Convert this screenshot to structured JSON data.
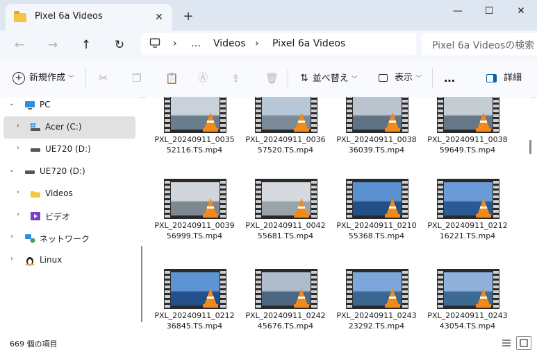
{
  "window": {
    "tab_title": "Pixel 6a Videos",
    "tab_close_icon": "close-icon",
    "new_tab_icon": "plus-icon",
    "minimize_icon": "minimize-icon",
    "maximize_icon": "maximize-icon",
    "close_icon": "close-icon"
  },
  "address": {
    "computer_icon": "computer-icon",
    "overflow": "…",
    "crumbs": [
      "Videos",
      "Pixel 6a Videos"
    ],
    "search_placeholder": "Pixel 6a Videosの検索"
  },
  "toolbar": {
    "new_label": "新規作成",
    "sort_label": "並べ替え",
    "view_label": "表示",
    "more_label": "…",
    "details_label": "詳細"
  },
  "sidebar": {
    "items": [
      {
        "label": "PC",
        "icon": "pc-icon"
      },
      {
        "label": "Acer (C:)",
        "icon": "windows-drive-icon"
      },
      {
        "label": "UE720 (D:)",
        "icon": "drive-icon"
      },
      {
        "label": "UE720 (D:)",
        "icon": "drive-icon"
      },
      {
        "label": "Videos",
        "icon": "folder-icon"
      },
      {
        "label": "ビデオ",
        "icon": "video-folder-icon"
      },
      {
        "label": "ネットワーク",
        "icon": "network-icon"
      },
      {
        "label": "Linux",
        "icon": "linux-icon"
      }
    ]
  },
  "files": [
    {
      "name": "PXL_20240911_003552116.TS.mp4",
      "sky": "#c9d2dc",
      "sea": "#6a7d8c"
    },
    {
      "name": "PXL_20240911_003657520.TS.mp4",
      "sky": "#b8c7d6",
      "sea": "#7a8a96"
    },
    {
      "name": "PXL_20240911_003836039.TS.mp4",
      "sky": "#b9c4cf",
      "sea": "#5f7385"
    },
    {
      "name": "PXL_20240911_003859649.TS.mp4",
      "sky": "#c4ccd4",
      "sea": "#667888"
    },
    {
      "name": "PXL_20240911_003956999.TS.mp4",
      "sky": "#d0d6dc",
      "sea": "#7c8790"
    },
    {
      "name": "PXL_20240911_004255681.TS.mp4",
      "sky": "#d6dade",
      "sea": "#9aa3aa"
    },
    {
      "name": "PXL_20240911_021055368.TS.mp4",
      "sky": "#5a8fd0",
      "sea": "#244f86"
    },
    {
      "name": "PXL_20240911_021216221.TS.mp4",
      "sky": "#6b9ad6",
      "sea": "#2a5a94"
    },
    {
      "name": "PXL_20240911_021236845.TS.mp4",
      "sky": "#5e93d6",
      "sea": "#21508a"
    },
    {
      "name": "PXL_20240911_024245676.TS.mp4",
      "sky": "#aebccb",
      "sea": "#4d6782"
    },
    {
      "name": "PXL_20240911_024323292.TS.mp4",
      "sky": "#7da7da",
      "sea": "#3a6690"
    },
    {
      "name": "PXL_20240911_024343054.TS.mp4",
      "sky": "#8fb2dc",
      "sea": "#3c6a94"
    }
  ],
  "status": {
    "count_text": "669 個の項目"
  }
}
